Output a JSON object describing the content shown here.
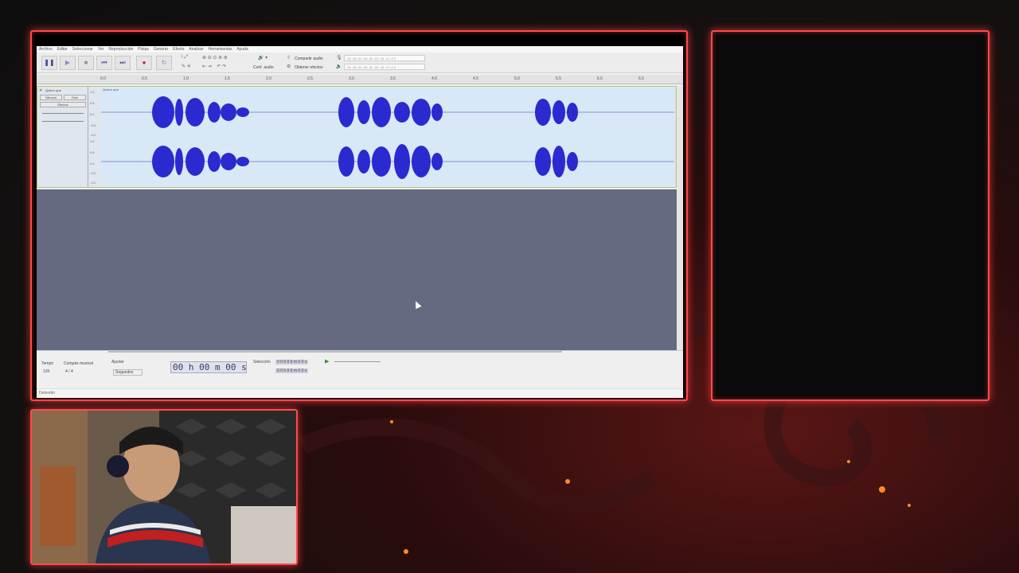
{
  "app": {
    "menu": [
      "Archivo",
      "Editar",
      "Seleccionar",
      "Ver",
      "Reproducción",
      "Pistas",
      "Generar",
      "Efecto",
      "Analizar",
      "Herramientas",
      "Ayuda"
    ],
    "toolbar": {
      "pause_icon": "pause-icon",
      "play_icon": "play-icon",
      "stop_icon": "stop-icon",
      "skip_start_icon": "skip-start-icon",
      "skip_end_icon": "skip-end-icon",
      "record_icon": "record-icon",
      "loop_icon": "loop-icon",
      "audio_setup_label": "Conf. audio",
      "share_audio_label": "Compartir audio",
      "get_effects_label": "Obtener efectos",
      "meter_record": "-54 -48 -42 -36 -30 -24 -18 -12 -6 0",
      "meter_play": "-54 -48 -42 -36 -30 -24 -18 -12 -6 0"
    },
    "ruler": {
      "ticks": [
        "0.0",
        "0.5",
        "1.0",
        "1.5",
        "2.0",
        "2.5",
        "3.0",
        "3.5",
        "4.0",
        "4.5",
        "5.0",
        "5.5",
        "6.0",
        "6.5"
      ]
    },
    "track": {
      "name": "Quiero que",
      "clip_name": "Quiero que",
      "mute_label": "Silencio",
      "solo_label": "Solo",
      "effects_label": "Efectos",
      "scale_top": [
        "1.0",
        "0.5",
        "0.0",
        "-0.5",
        "-1.0"
      ],
      "scale_bottom": [
        "1.0",
        "0.5",
        "0.0",
        "-0.5",
        "-1.0"
      ]
    },
    "bottom": {
      "tempo_label": "Tempo",
      "tempo_value": "120",
      "time_sig_label": "Compás musical",
      "time_sig_value": "4 / 4",
      "snap_label": "Ajustar",
      "snap_unit": "Segundos",
      "timecode": "00 h 00 m 00 s",
      "selection_label": "Selección",
      "selection_start": "0 0 h 0 0 m 0 0 s",
      "selection_end": "0 0 h 0 0 m 0 0 s"
    },
    "status_text": "Detenido"
  }
}
